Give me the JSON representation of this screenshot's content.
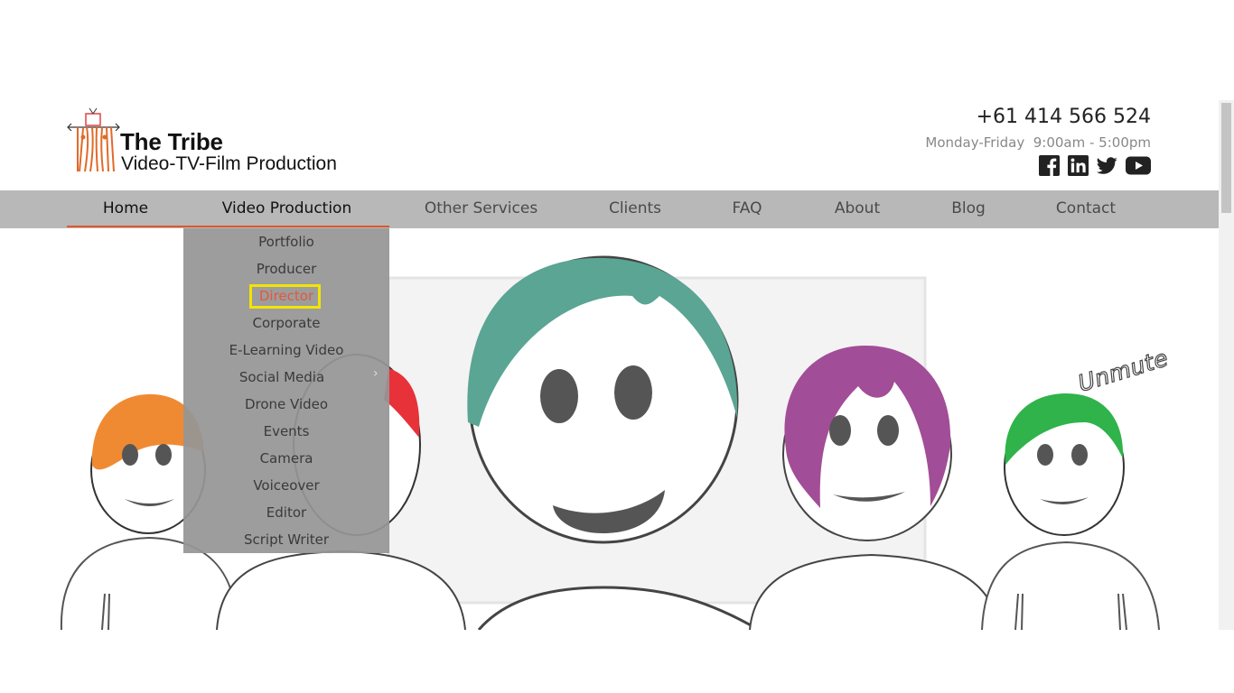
{
  "brand": {
    "title": "The Tribe",
    "subtitle": "Video-TV-Film Production",
    "logo_icon": "tribe-tv-figures-logo"
  },
  "contact": {
    "phone": "+61 414 566 524",
    "hours": "Monday-Friday  9:00am - 5:00pm"
  },
  "socials": [
    {
      "name": "facebook-icon"
    },
    {
      "name": "linkedin-icon"
    },
    {
      "name": "twitter-icon"
    },
    {
      "name": "youtube-icon"
    }
  ],
  "nav": {
    "items": [
      {
        "label": "Home",
        "active": true
      },
      {
        "label": "Video Production",
        "active": true
      },
      {
        "label": "Other Services"
      },
      {
        "label": "Clients"
      },
      {
        "label": "FAQ"
      },
      {
        "label": "About"
      },
      {
        "label": "Blog"
      },
      {
        "label": "Contact"
      }
    ]
  },
  "dropdown": {
    "items": [
      {
        "label": "Portfolio"
      },
      {
        "label": "Producer"
      },
      {
        "label": "Director",
        "highlighted": true
      },
      {
        "label": "Corporate"
      },
      {
        "label": "E-Learning Video"
      },
      {
        "label": "Social Media",
        "has_submenu": true
      },
      {
        "label": "Drone Video"
      },
      {
        "label": "Events"
      },
      {
        "label": "Camera"
      },
      {
        "label": "Voiceover"
      },
      {
        "label": "Editor"
      },
      {
        "label": "Script Writer"
      }
    ]
  },
  "hero": {
    "unmute_label": "Unmute"
  },
  "colors": {
    "accent": "#e0552c",
    "nav_bg": "#b8b8b8",
    "highlight_box": "#f2e400",
    "teal_hair": "#5aa593",
    "purple_hair": "#a24d97",
    "orange_hair": "#f08a32",
    "green_hair": "#2fb34a",
    "red_hair": "#e8323a"
  }
}
